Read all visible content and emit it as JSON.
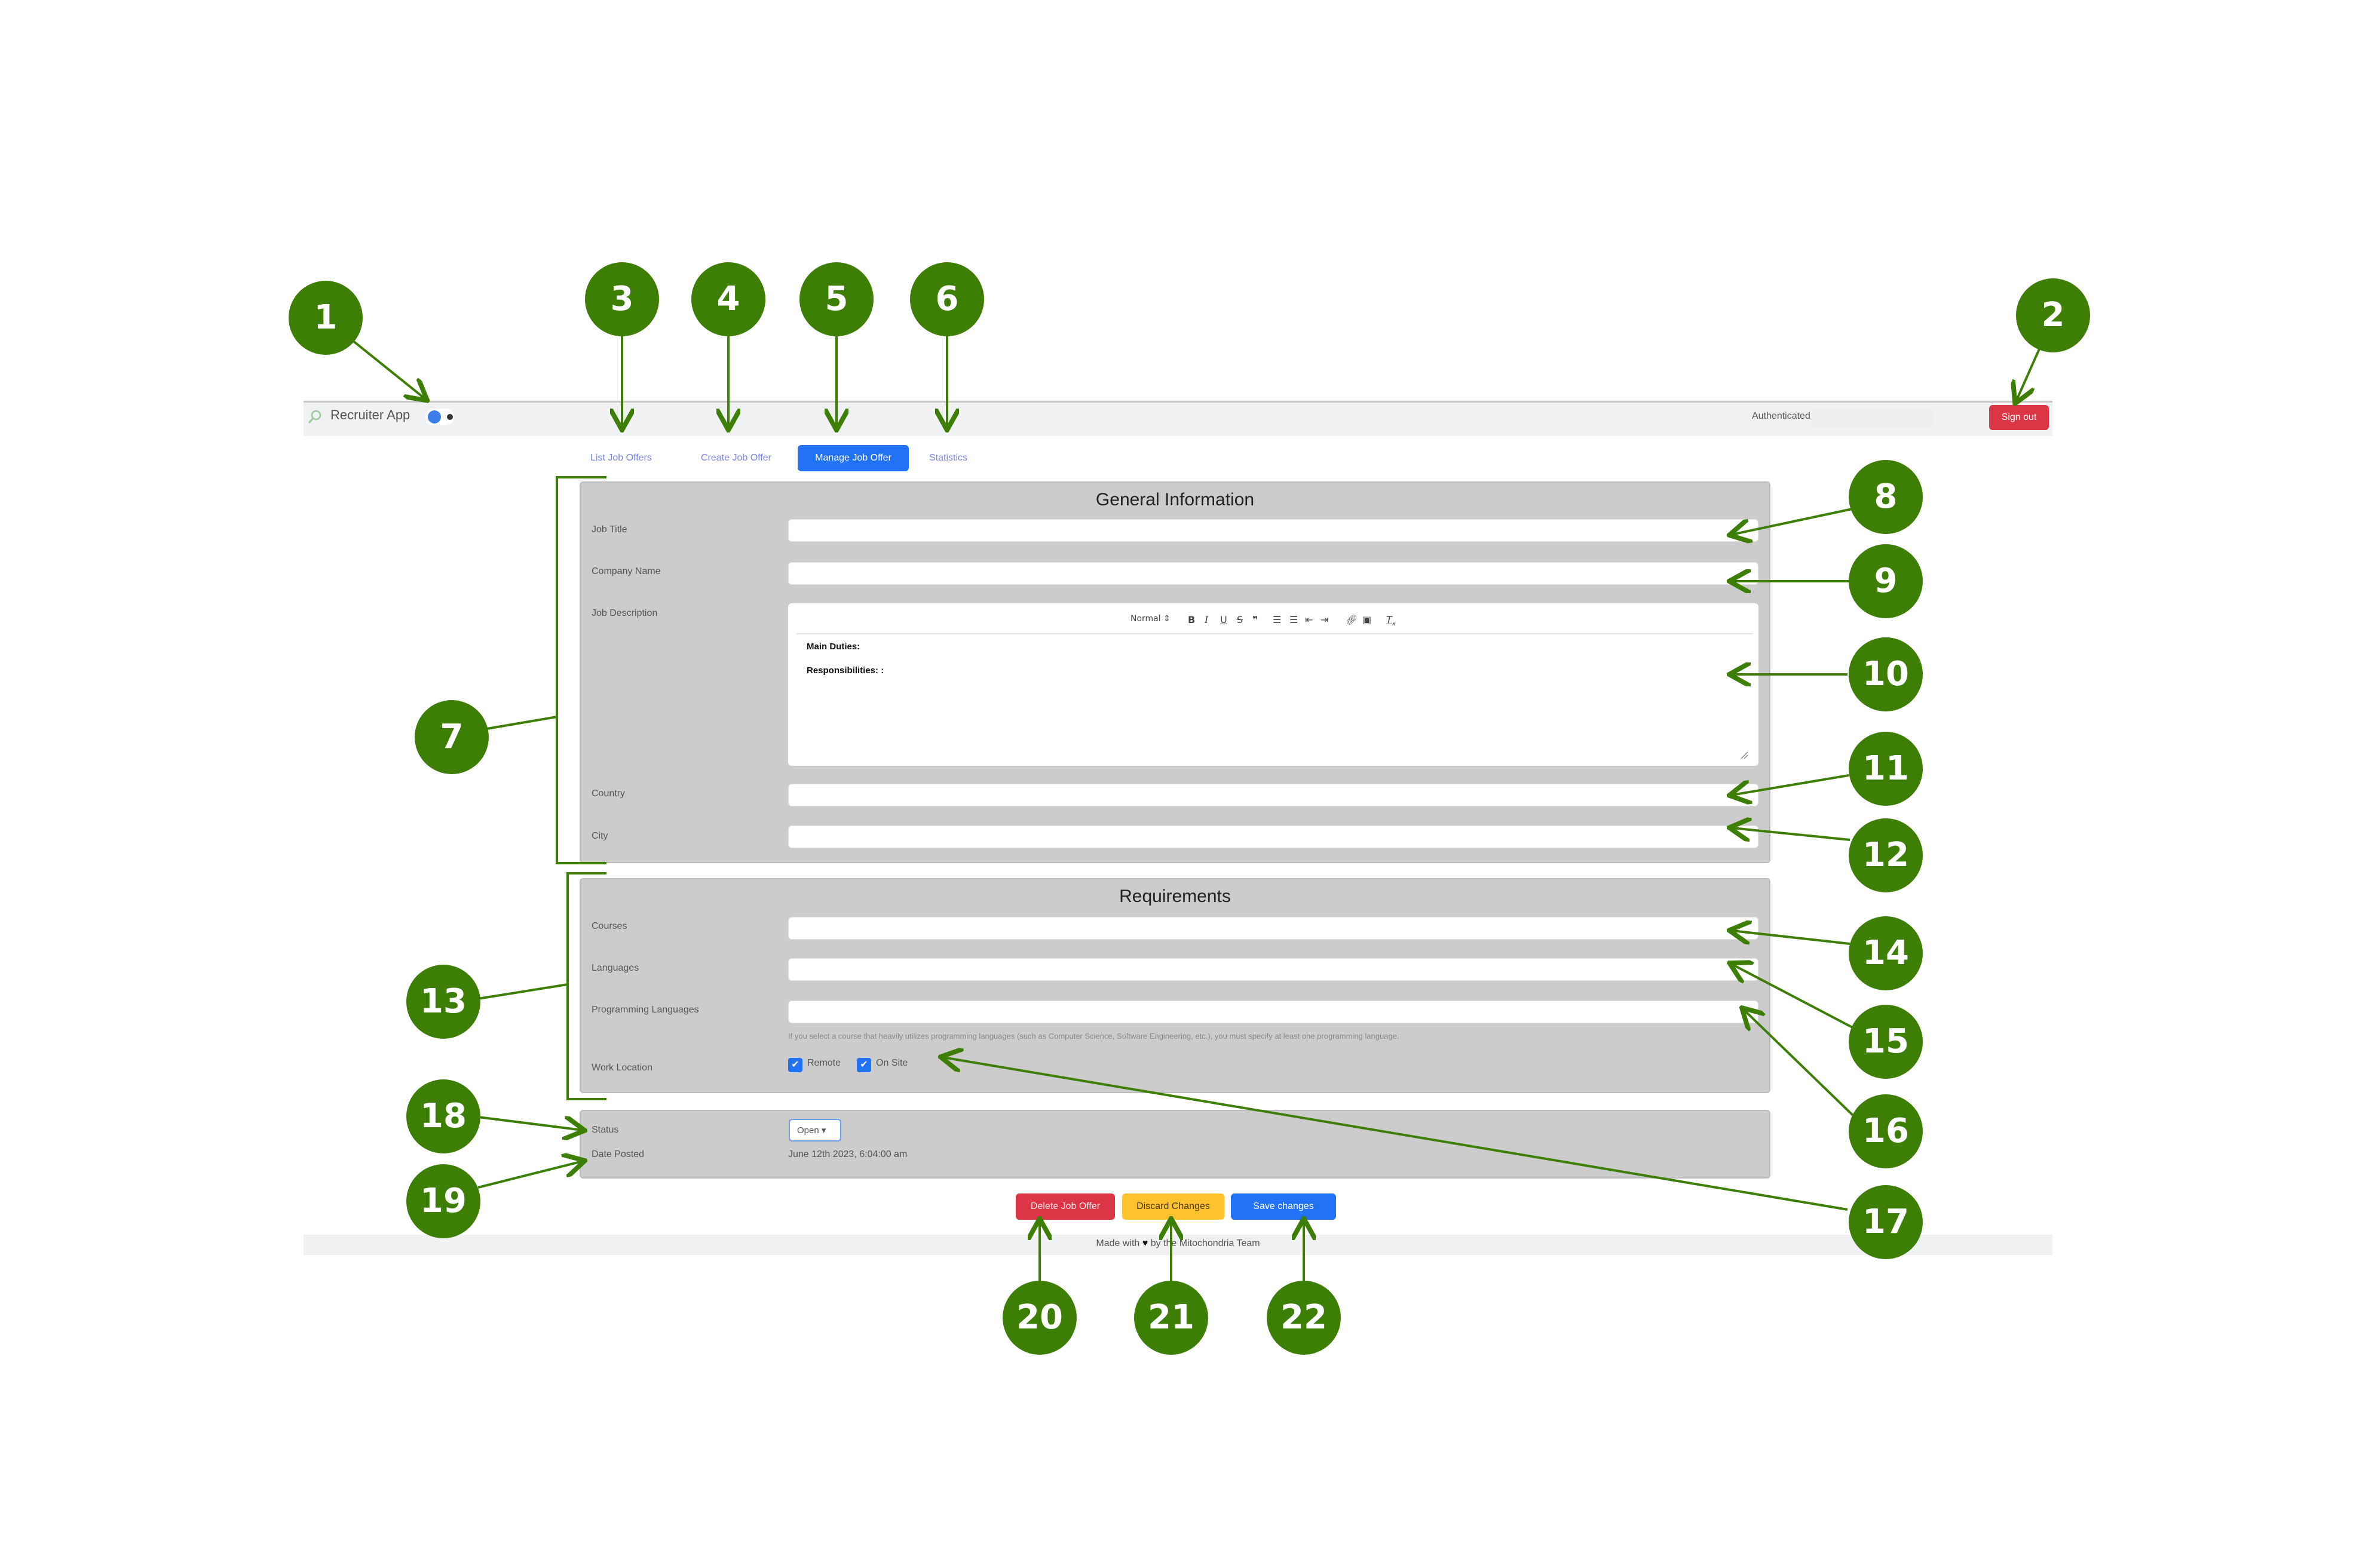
{
  "navbar": {
    "brand": "Recruiter App",
    "brand_icon": "magnifier-person-icon",
    "theme_toggle": "theme-toggle",
    "auth_label": "Authenticated as",
    "auth_value": "",
    "sign_out": "Sign out"
  },
  "tabs": [
    {
      "label": "List Job Offers",
      "active": false
    },
    {
      "label": "Create Job Offer",
      "active": false
    },
    {
      "label": "Manage Job Offer",
      "active": true
    },
    {
      "label": "Statistics",
      "active": false
    }
  ],
  "general": {
    "title": "General Information",
    "job_title_label": "Job Title",
    "job_title_value": "",
    "company_label": "Company Name",
    "company_value": "",
    "description_label": "Job Description",
    "editor": {
      "format": "Normal",
      "tools": [
        "bold",
        "italic",
        "underline",
        "strike",
        "blockquote",
        "ordered-list",
        "bullet-list",
        "indent-decrease",
        "indent-increase",
        "link",
        "image",
        "clear-format"
      ],
      "lines": [
        "Main Duties:",
        "Responsibilities: :"
      ]
    },
    "country_label": "Country",
    "country_value": "",
    "city_label": "City",
    "city_value": ""
  },
  "requirements": {
    "title": "Requirements",
    "courses_label": "Courses",
    "languages_label": "Languages",
    "prog_languages_label": "Programming Languages",
    "help_text": "If you select a course that heavily utilizes programming languages (such as Computer Science, Software Engineering, etc.), you must specify at least one programming language.",
    "work_location_label": "Work Location",
    "remote_label": "Remote",
    "remote_checked": true,
    "onsite_label": "On Site",
    "onsite_checked": true
  },
  "status": {
    "status_label": "Status",
    "status_value": "Open ▾",
    "date_label": "Date Posted",
    "date_value": "June 12th 2023, 6:04:00 am"
  },
  "actions": {
    "delete": "Delete Job Offer",
    "discard": "Discard Changes",
    "save": "Save changes"
  },
  "footer": {
    "before": "Made with",
    "heart": "♥",
    "after": "by the Mitochondria Team"
  },
  "colors": {
    "annotation": "#3d7f05",
    "primary": "#2272f6",
    "danger": "#dc3545",
    "warning": "#ffc12d",
    "panel": "#cccccc"
  },
  "annotations": [
    "1",
    "2",
    "3",
    "4",
    "5",
    "6",
    "7",
    "8",
    "9",
    "10",
    "11",
    "12",
    "13",
    "14",
    "15",
    "16",
    "17",
    "18",
    "19",
    "20",
    "21",
    "22"
  ]
}
